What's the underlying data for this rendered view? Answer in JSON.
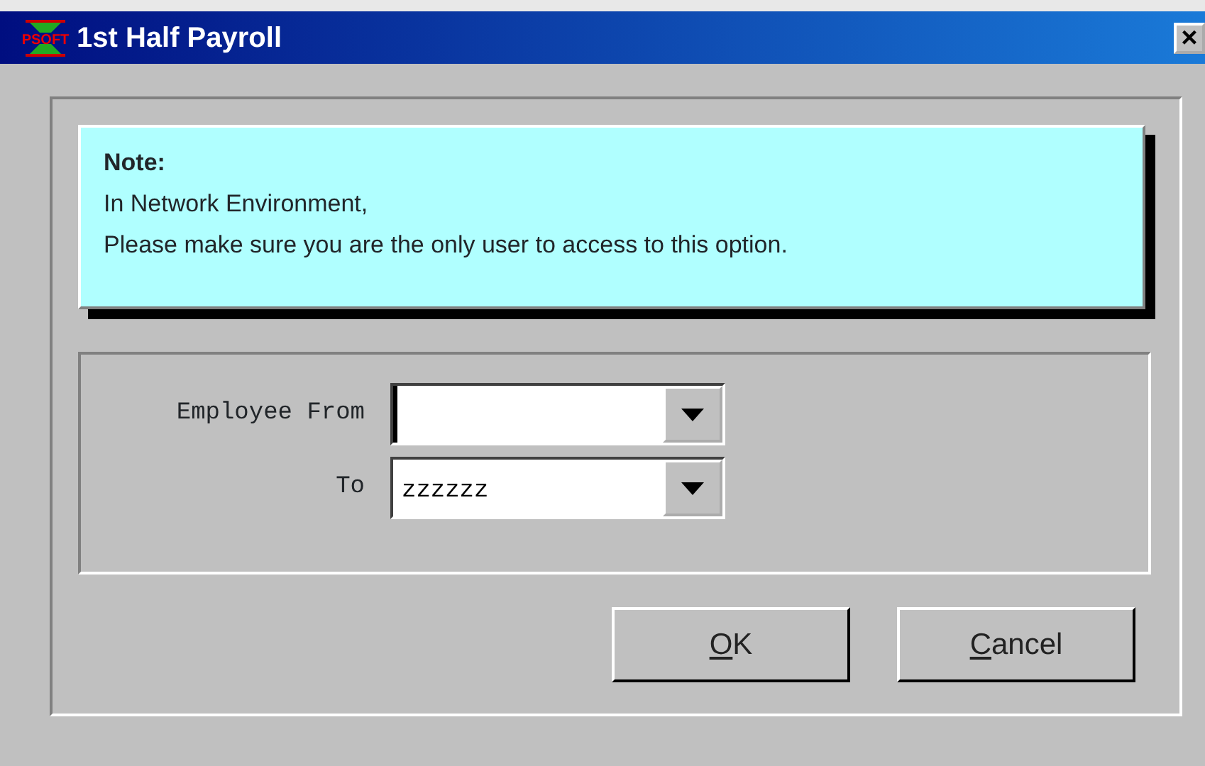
{
  "window": {
    "title": "1st Half Payroll",
    "logo_text": "PSOFT",
    "close": "×"
  },
  "note": {
    "heading": "Note:",
    "lines": [
      "In Network Environment,",
      "Please make sure you are the only user to access to this option."
    ]
  },
  "fields": [
    {
      "label": "Employee From",
      "focused": true
    },
    {
      "label": "To",
      "value": "zzzzzz",
      "focused": false
    }
  ],
  "buttons": [
    {
      "label": "OK",
      "first_letter_underlined": true
    },
    {
      "label": "Cancel",
      "first_letter_underlined": true
    }
  ]
}
